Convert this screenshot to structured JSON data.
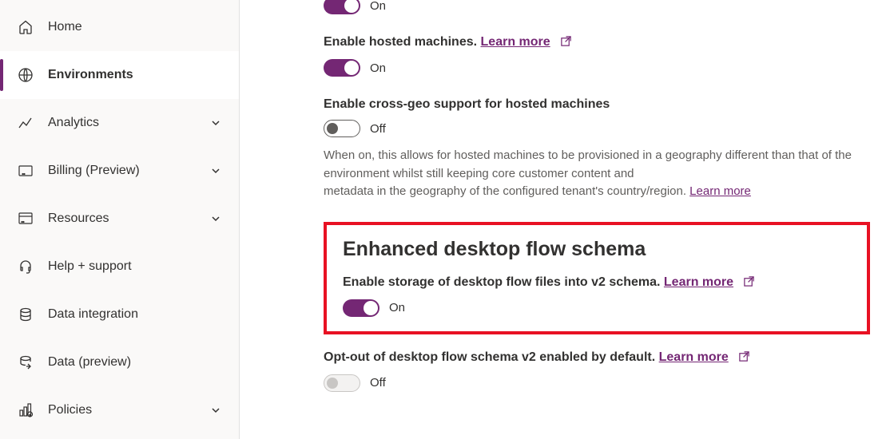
{
  "sidebar": {
    "items": [
      {
        "label": "Home",
        "icon": "home-icon"
      },
      {
        "label": "Environments",
        "icon": "globe-icon"
      },
      {
        "label": "Analytics",
        "icon": "analytics-icon"
      },
      {
        "label": "Billing (Preview)",
        "icon": "billing-icon"
      },
      {
        "label": "Resources",
        "icon": "resources-icon"
      },
      {
        "label": "Help + support",
        "icon": "headset-icon"
      },
      {
        "label": "Data integration",
        "icon": "data-integration-icon"
      },
      {
        "label": "Data (preview)",
        "icon": "data-preview-icon"
      },
      {
        "label": "Policies",
        "icon": "policies-icon"
      }
    ]
  },
  "toggles": {
    "on": "On",
    "off": "Off"
  },
  "learnMore": "Learn more",
  "settings": {
    "hostedMachines": {
      "label": "Enable hosted machines."
    },
    "crossGeo": {
      "label": "Enable cross-geo support for hosted machines",
      "help1": "When on, this allows for hosted machines to be provisioned in a geography different than that of the environment whilst still keeping core customer content and",
      "help2": "metadata in the geography of the configured tenant's country/region."
    },
    "section": {
      "title": "Enhanced desktop flow schema",
      "enableV2": "Enable storage of desktop flow files into v2 schema."
    },
    "optOut": {
      "label": "Opt-out of desktop flow schema v2 enabled by default."
    }
  }
}
